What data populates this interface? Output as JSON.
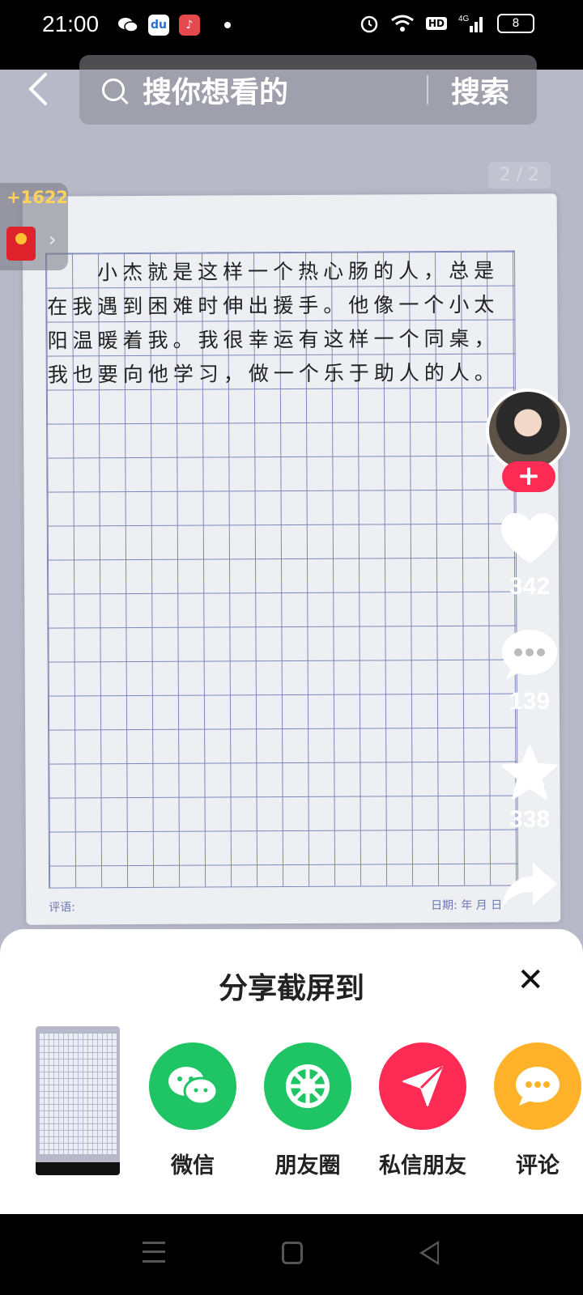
{
  "status_bar": {
    "time": "21:00",
    "battery": "8",
    "network": "4G",
    "hd": "HD",
    "left_icons": [
      "wechat-icon",
      "baidu-icon",
      "music-icon",
      "dot-icon"
    ],
    "right_icons": [
      "alarm-icon",
      "wifi-icon",
      "hd-icon",
      "signal-icon",
      "battery-icon"
    ]
  },
  "search": {
    "placeholder": "搜你想看的",
    "button_label": "搜索"
  },
  "reward": {
    "count": "+1622"
  },
  "page_indicator": "2 / 2",
  "essay": {
    "lines": [
      "　　小杰就是这样一个热心肠的人，总是",
      "在我遇到困难时伸出援手。他像一个小太",
      "阳温暖着我。我很幸运有这样一个同桌，",
      "我也要向他学习，做一个乐于助人的人。"
    ],
    "footer_left": "评语:",
    "footer_date": "日期:   年   月   日"
  },
  "actions": {
    "likes": "342",
    "comments": "139",
    "favorites": "338"
  },
  "share_sheet": {
    "title": "分享截屏到",
    "targets": [
      {
        "label": "微信",
        "icon": "wechat-icon",
        "color": "#1fc465"
      },
      {
        "label": "朋友圈",
        "icon": "moments-icon",
        "color": "#1fc465"
      },
      {
        "label": "私信朋友",
        "icon": "send-icon",
        "color": "#fe2c55"
      },
      {
        "label": "评论",
        "icon": "comment-icon",
        "color": "#ffb22a"
      }
    ]
  },
  "colors": {
    "accent": "#fe2c55",
    "reward_text": "#ffd35a"
  }
}
